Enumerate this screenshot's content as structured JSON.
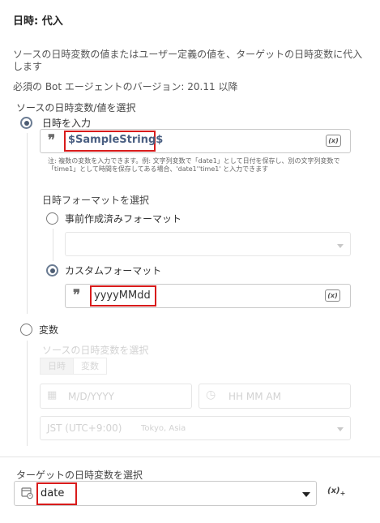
{
  "header": {
    "title": "日時: 代入"
  },
  "description": "ソースの日時変数の値またはユーザー定義の値を、ターゲットの日時変数に代入します",
  "requirement": "必須の Bot エージェントのバージョン: 20.11 以降",
  "source": {
    "label": "ソースの日時変数/値を選択",
    "enter_datetime": {
      "label": "日時を入力",
      "value": "$SampleString$",
      "var_button": "(x)",
      "note": "注: 複数の変数を入力できます。例: 文字列変数で「date1」として日付を保存し、別の文字列変数で「time1」として時間を保存してある場合、'date1''time1' と入力できます"
    },
    "format": {
      "label": "日時フォーマットを選択",
      "predefined_label": "事前作成済みフォーマット",
      "custom_label": "カスタムフォーマット",
      "custom_value": "yyyyMMdd",
      "var_button": "(x)"
    },
    "variable": {
      "label": "変数",
      "sub_label": "ソースの日時変数を選択",
      "seg_datetime": "日時",
      "seg_variable": "変数",
      "date_placeholder": "M/D/YYYY",
      "time_placeholder": "HH MM AM",
      "timezone": "JST (UTC+9:00)",
      "timezone_city": "Tokyo, Asia"
    }
  },
  "target": {
    "label": "ターゲットの日時変数を選択",
    "value": "date",
    "var_button": "(x)"
  }
}
